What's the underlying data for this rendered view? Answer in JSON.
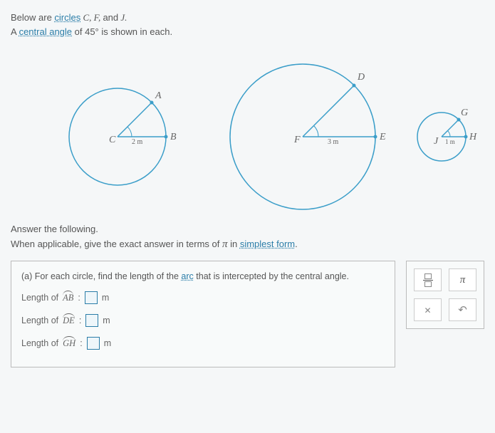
{
  "intro": {
    "line1_pre": "Below are ",
    "term_circles": "circles",
    "line1_vars": " C, F, ",
    "line1_and": "and",
    "line1_varJ": " J.",
    "line2_pre": "A ",
    "term_central_angle": "central angle",
    "line2_rest": " of 45° is shown in each."
  },
  "circles": {
    "C": {
      "center": "C",
      "ptA": "A",
      "ptB": "B",
      "radius_label": "2 m"
    },
    "F": {
      "center": "F",
      "ptD": "D",
      "ptE": "E",
      "radius_label": "3 m"
    },
    "J": {
      "center": "J",
      "ptG": "G",
      "ptH": "H",
      "radius_label": "1 m"
    }
  },
  "answer_intro": {
    "l1": "Answer the following.",
    "l2_pre": "When applicable, give the exact answer in terms of ",
    "pi": "π",
    "l2_mid": " in ",
    "term_simplest": "simplest form",
    "l2_end": "."
  },
  "part_a": {
    "prompt_pre": "(a)  For each circle, find the length of the ",
    "term_arc": "arc",
    "prompt_post": " that is intercepted by the central angle.",
    "rows": {
      "AB": {
        "label_pre": "Length of ",
        "arc": "AB",
        "colon": ":",
        "unit": "m"
      },
      "DE": {
        "label_pre": "Length of ",
        "arc": "DE",
        "colon": ":",
        "unit": "m"
      },
      "GH": {
        "label_pre": "Length of ",
        "arc": "GH",
        "colon": ":",
        "unit": "m"
      }
    }
  },
  "toolbox": {
    "pi": "π"
  },
  "chart_data": [
    {
      "type": "circle_with_angle",
      "name": "C",
      "radius_m": 2,
      "central_angle_deg": 45,
      "points": [
        "A",
        "B"
      ]
    },
    {
      "type": "circle_with_angle",
      "name": "F",
      "radius_m": 3,
      "central_angle_deg": 45,
      "points": [
        "D",
        "E"
      ]
    },
    {
      "type": "circle_with_angle",
      "name": "J",
      "radius_m": 1,
      "central_angle_deg": 45,
      "points": [
        "G",
        "H"
      ]
    }
  ]
}
